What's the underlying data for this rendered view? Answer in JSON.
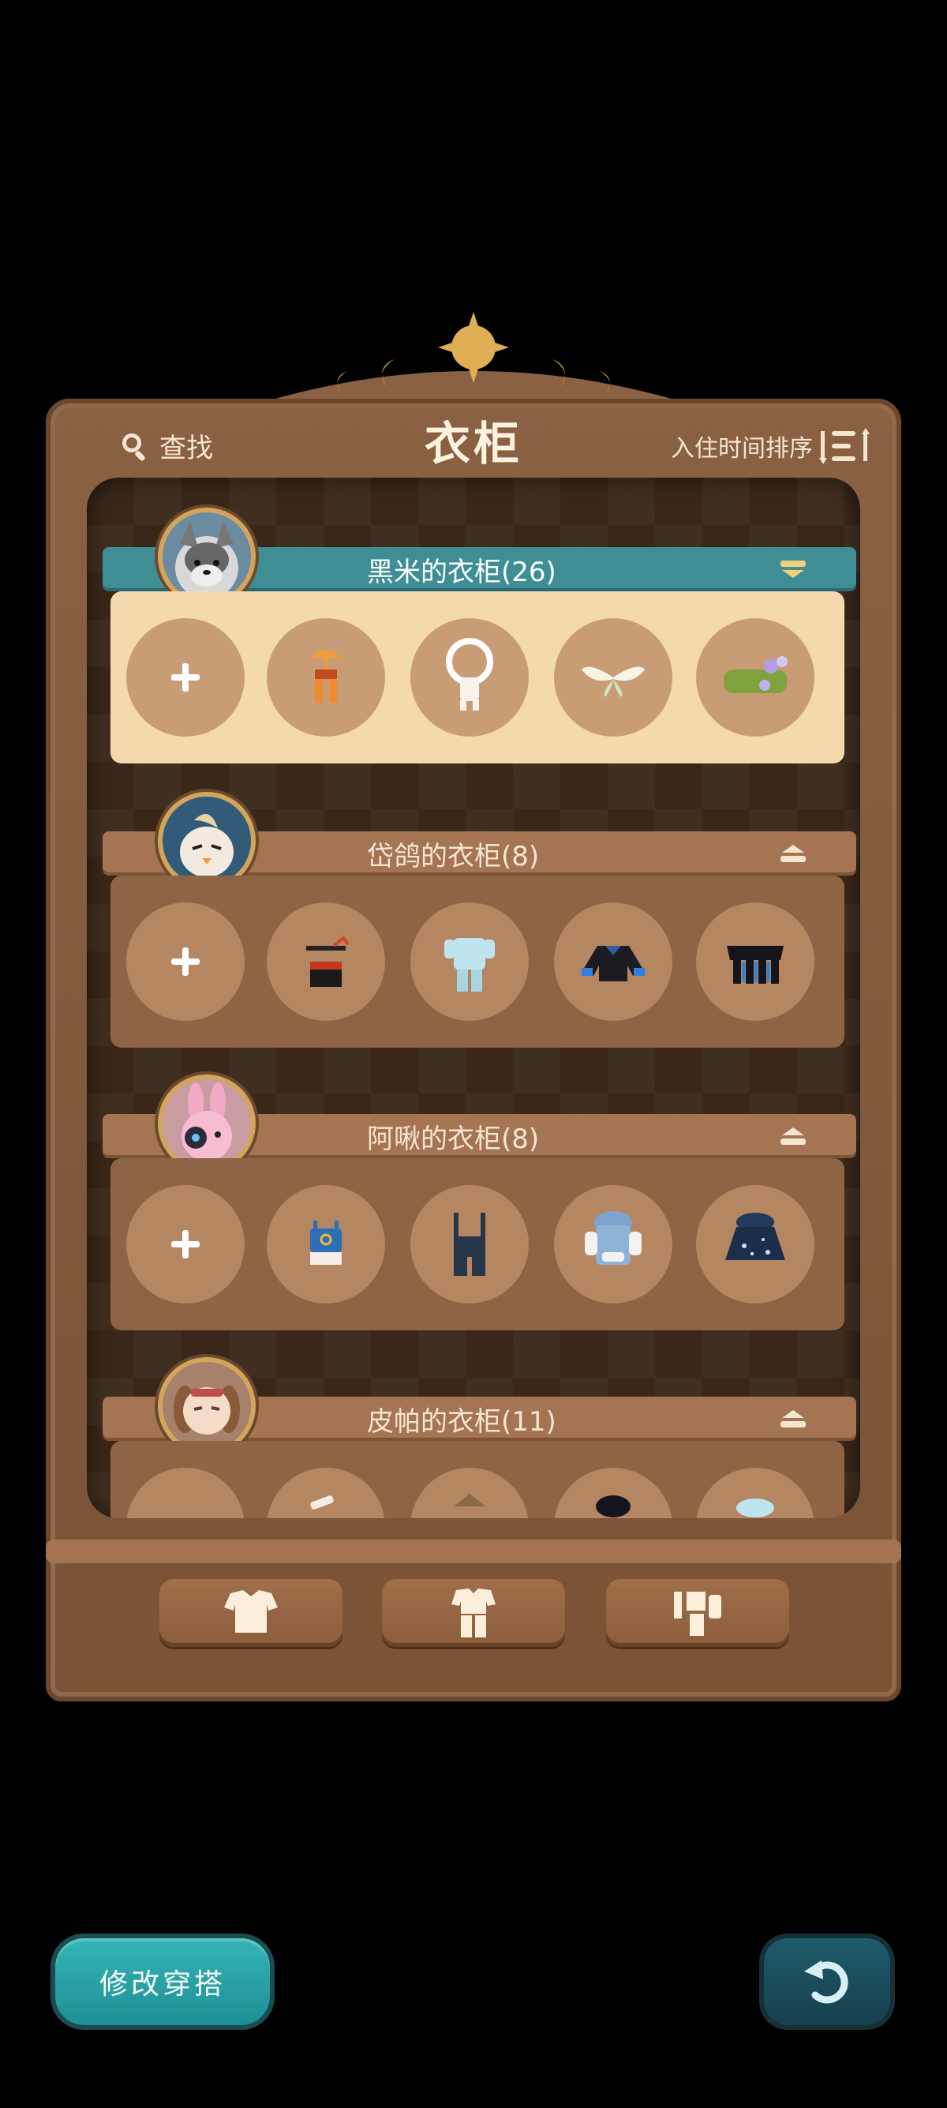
{
  "header": {
    "search_label": "查找",
    "title": "衣柜",
    "sort_label": "入住时间排序"
  },
  "wardrobes": [
    {
      "title": "黑米的衣柜(26)",
      "active": true,
      "banner_color": "#3f8e96",
      "tray_color": "#f3d9ad",
      "avatar": "husky-dog-avatar",
      "items": [
        "add",
        "orange-umbrella-hat-overalls",
        "white-fluffy-outfit",
        "white-butterfly-wings",
        "green-moss-flower-cloak"
      ]
    },
    {
      "title": "岱鸽的衣柜(8)",
      "active": false,
      "banner_color": "#a57453",
      "tray_color": "#8f6444",
      "avatar": "pigeon-avatar",
      "items": [
        "add",
        "black-spiked-shorts-outfit",
        "light-blue-pajamas",
        "black-blue-jacket",
        "black-fringe-skirt"
      ]
    },
    {
      "title": "阿啾的衣柜(8)",
      "active": false,
      "banner_color": "#a57453",
      "tray_color": "#8f6444",
      "avatar": "pink-rabbit-avatar",
      "items": [
        "add",
        "blue-tank-top",
        "navy-overalls",
        "blue-hoodie",
        "starry-navy-coat"
      ]
    },
    {
      "title": "皮帕的衣柜(11)",
      "active": false,
      "banner_color": "#a57453",
      "tray_color": "#8f6444",
      "avatar": "brown-dog-avatar",
      "items": [
        "add",
        "bandage-outfit",
        "brown-hat-outfit",
        "dark-hood-outfit",
        "light-blue-outfit"
      ]
    }
  ],
  "category_tabs": [
    "top-clothing-icon",
    "outfit-set-icon",
    "accessory-icon"
  ],
  "bottom_bar": {
    "edit_outfit_label": "修改穿搭",
    "back_icon": "back-arrow-icon"
  },
  "colors": {
    "cabinet_wood": "#8a6142",
    "inner_dark": "#3a2719",
    "teal_banner": "#3f8e96",
    "gold_trim": "#d3a55c"
  }
}
